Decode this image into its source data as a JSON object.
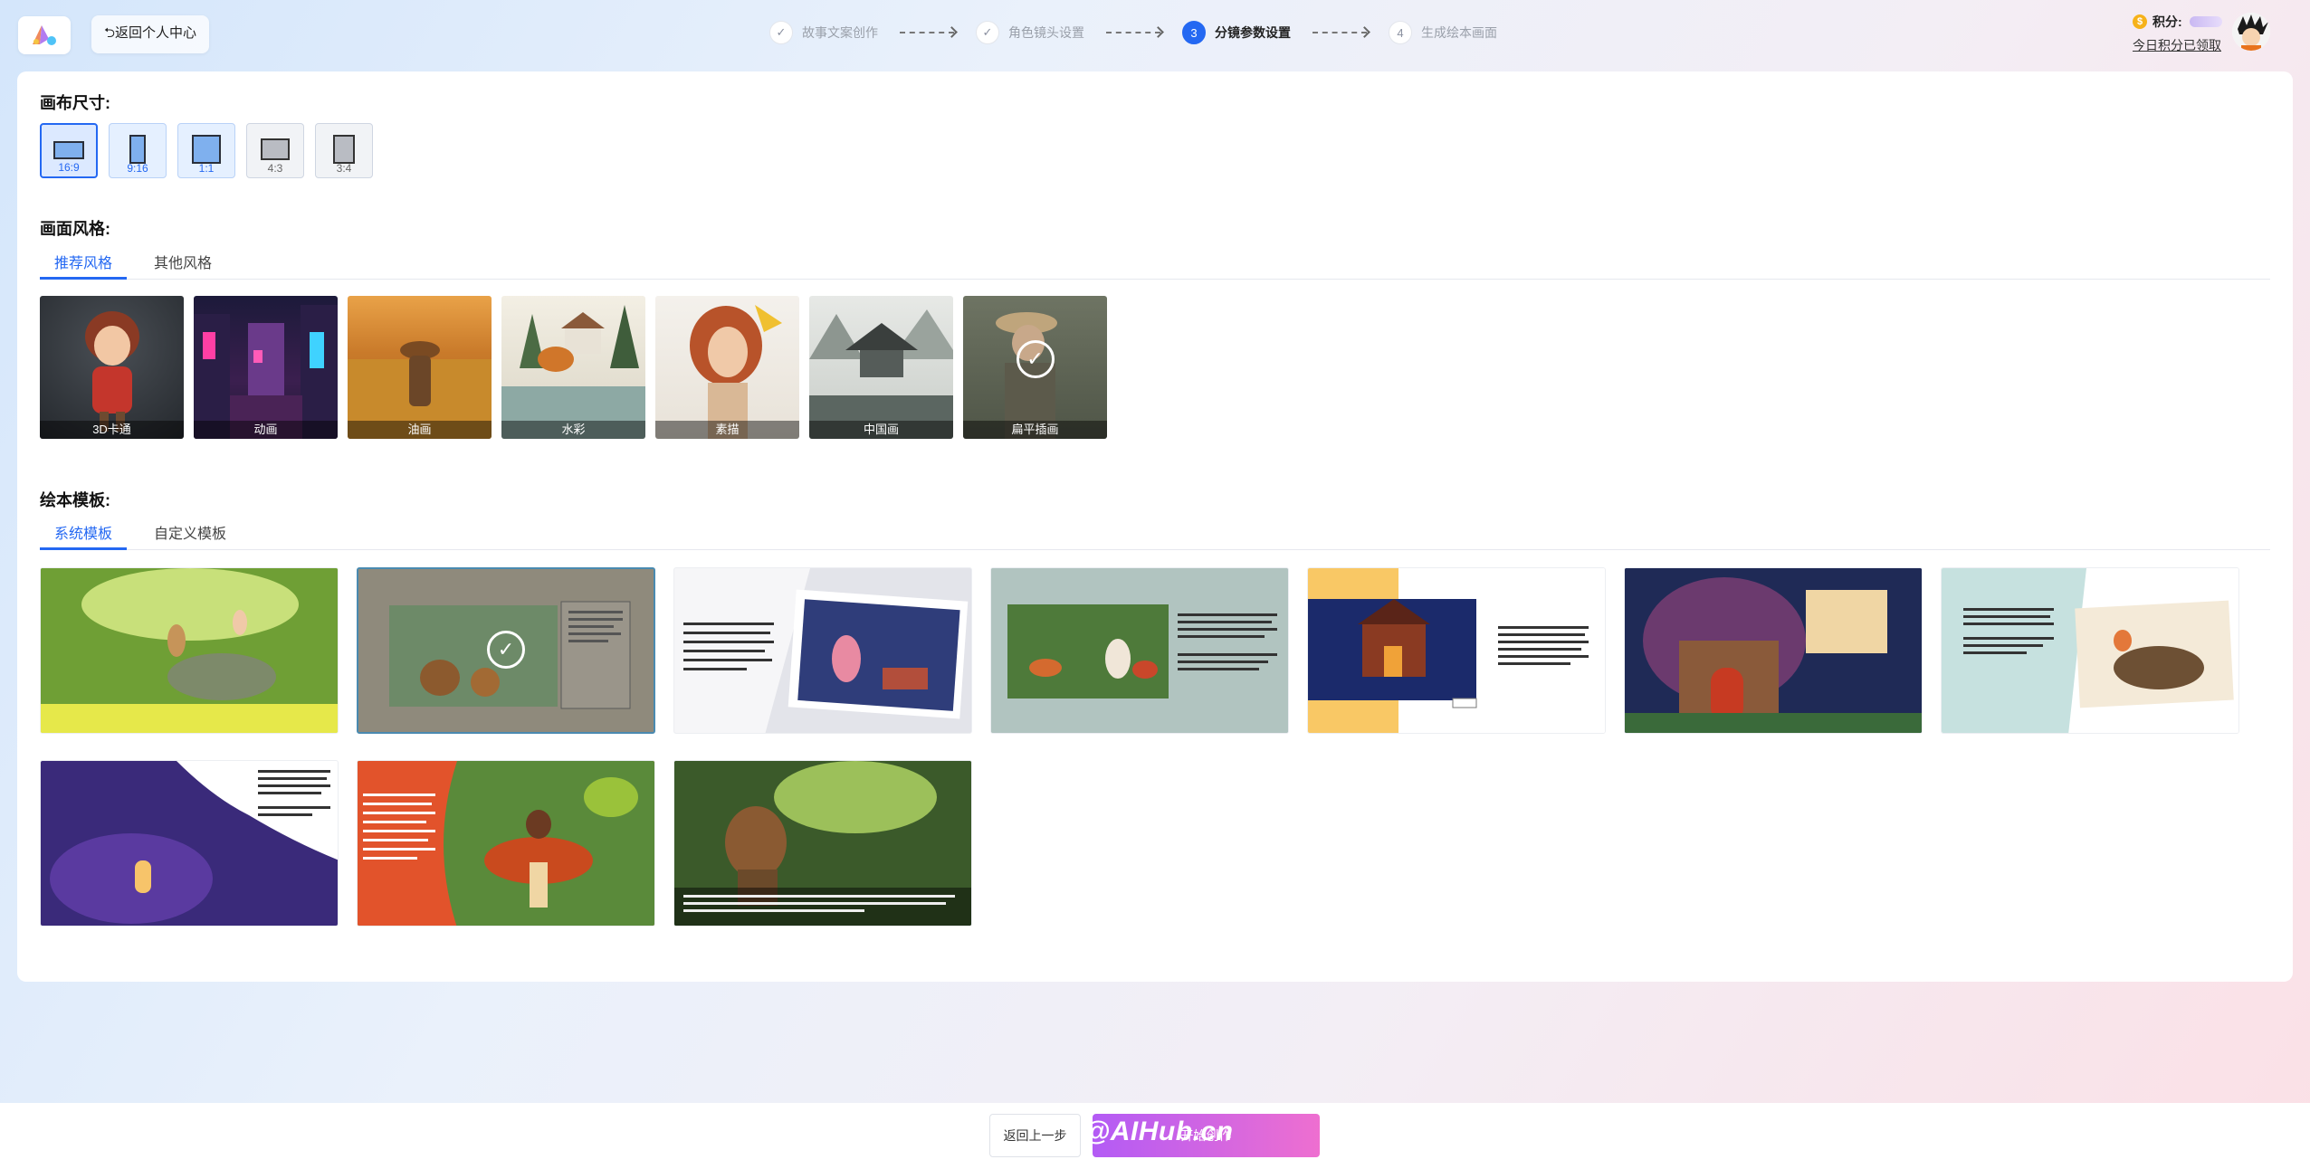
{
  "header": {
    "back_label": "⮌返回个人中心",
    "steps": [
      {
        "num": "✓",
        "label": "故事文案创作",
        "state": "done"
      },
      {
        "num": "✓",
        "label": "角色镜头设置",
        "state": "done"
      },
      {
        "num": "3",
        "label": "分镜参数设置",
        "state": "active"
      },
      {
        "num": "4",
        "label": "生成绘本画面",
        "state": "todo"
      }
    ],
    "points_label": "积分:",
    "daily_link": "今日积分已领取"
  },
  "canvas_size": {
    "title": "画布尺寸:",
    "options": [
      {
        "label": "16:9",
        "selected": true
      },
      {
        "label": "9:16",
        "selected": false
      },
      {
        "label": "1:1",
        "selected": false
      },
      {
        "label": "4:3",
        "selected": false
      },
      {
        "label": "3:4",
        "selected": false
      }
    ]
  },
  "style": {
    "title": "画面风格:",
    "tabs": [
      "推荐风格",
      "其他风格"
    ],
    "items": [
      "3D卡通",
      "动画",
      "油画",
      "水彩",
      "素描",
      "中国画",
      "扁平插画"
    ],
    "selected": "扁平插画"
  },
  "template": {
    "title": "绘本模板:",
    "tabs": [
      "系统模板",
      "自定义模板"
    ]
  },
  "footer": {
    "prev_label": "返回上一步",
    "next_label": "开始创作",
    "watermark": "@AIHub.cn"
  },
  "colors": {
    "accent": "#2468f2",
    "next_button_start": "#b35bf5",
    "next_button_end": "#ee6fd0"
  }
}
